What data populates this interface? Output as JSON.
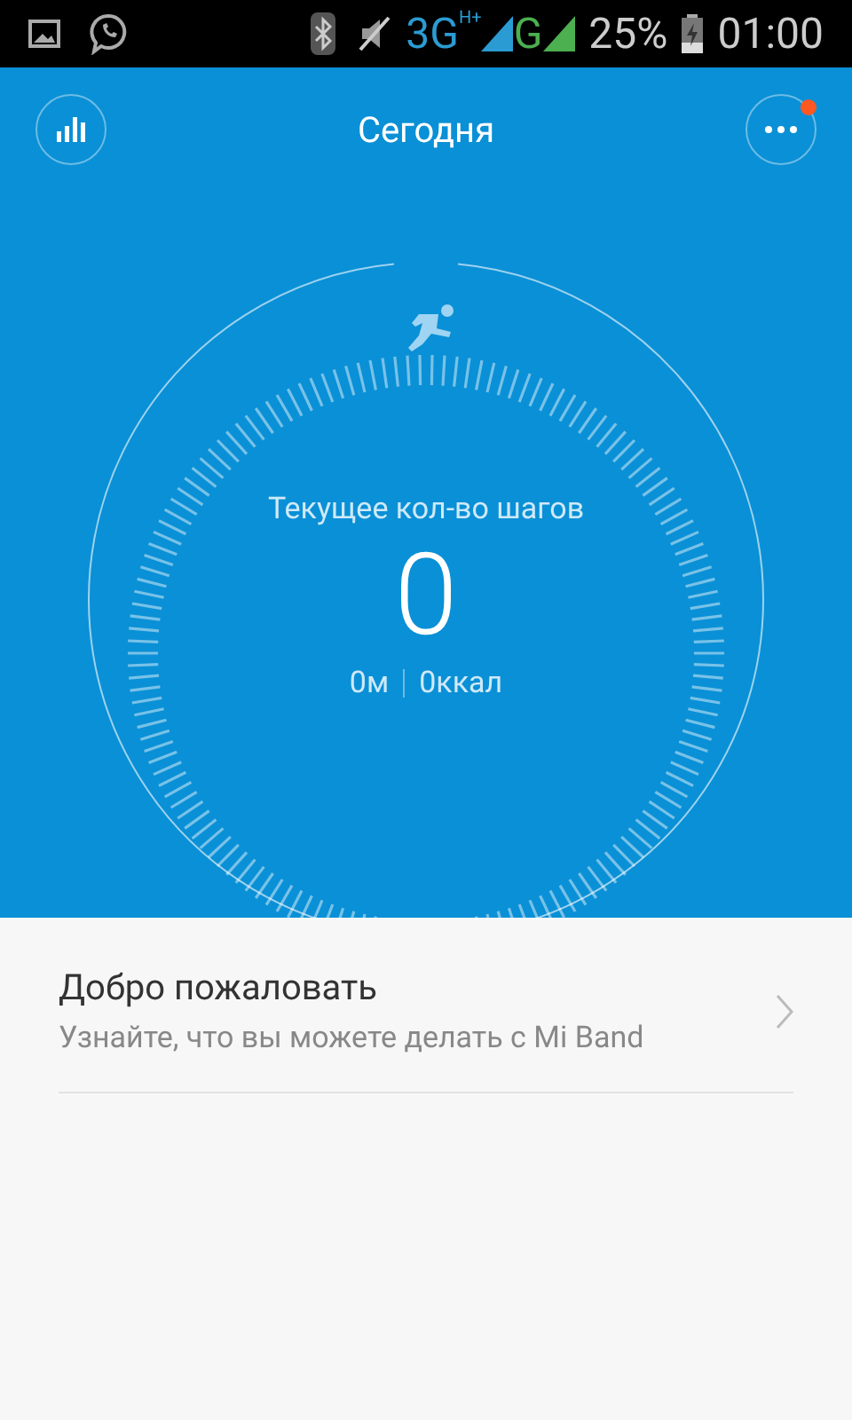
{
  "status_bar": {
    "networks": [
      {
        "text": "3G",
        "superscript": "H+",
        "color": "#2b9bd3"
      },
      {
        "text": "G",
        "color": "#4caf50"
      }
    ],
    "battery": "25%",
    "time": "01:00"
  },
  "header": {
    "title": "Сегодня",
    "menu_has_notification": true
  },
  "steps": {
    "label": "Текущее кол-во шагов",
    "count": "0",
    "distance": "0м",
    "calories": "0ккал"
  },
  "cards": [
    {
      "title": "Добро пожаловать",
      "subtitle": "Узнайте, что вы можете делать с Mi Band"
    }
  ]
}
